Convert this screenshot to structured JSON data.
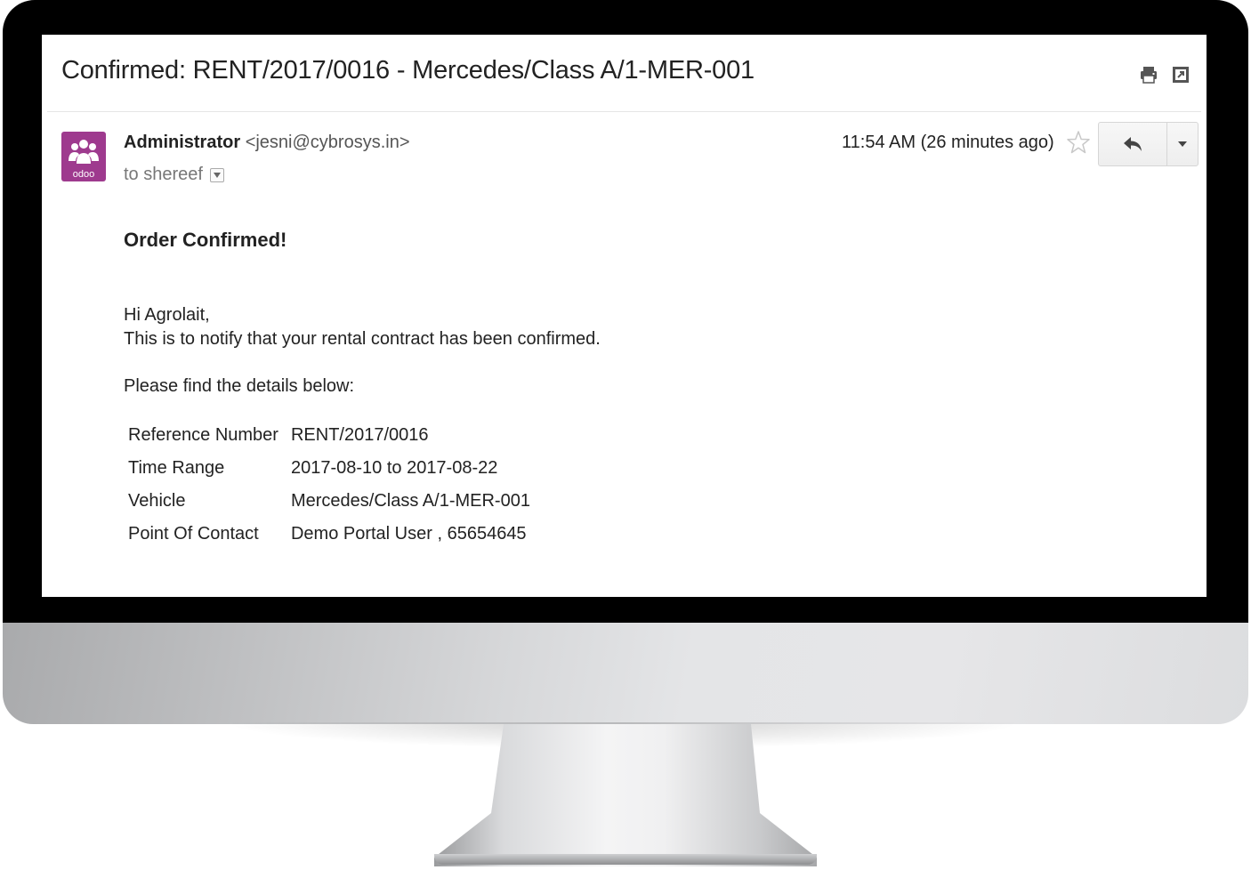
{
  "email": {
    "subject": "Confirmed: RENT/2017/0016 - Mercedes/Class A/1-MER-001",
    "toolbar_icons": [
      "print-icon",
      "open-in-new-window-icon"
    ],
    "sender_name": "Administrator",
    "sender_email": "<jesni@cybrosys.in>",
    "recipient": "to shereef",
    "timestamp": "11:54 AM (26 minutes ago)",
    "avatar_label": "odoo",
    "colors": {
      "avatar_bg": "#9e3a8e",
      "text": "#222222"
    }
  },
  "body": {
    "heading": "Order Confirmed!",
    "greeting": "Hi Agrolait,",
    "notify": "This is to notify that your rental contract has been confirmed.",
    "intro": "Please find the details below:",
    "details": [
      {
        "label": "Reference Number",
        "value": "RENT/2017/0016"
      },
      {
        "label": "Time Range",
        "value": "2017-08-10 to 2017-08-22"
      },
      {
        "label": "Vehicle",
        "value": "Mercedes/Class A/1-MER-001"
      },
      {
        "label": "Point Of Contact",
        "value": "Demo Portal User , 65654645"
      }
    ]
  }
}
